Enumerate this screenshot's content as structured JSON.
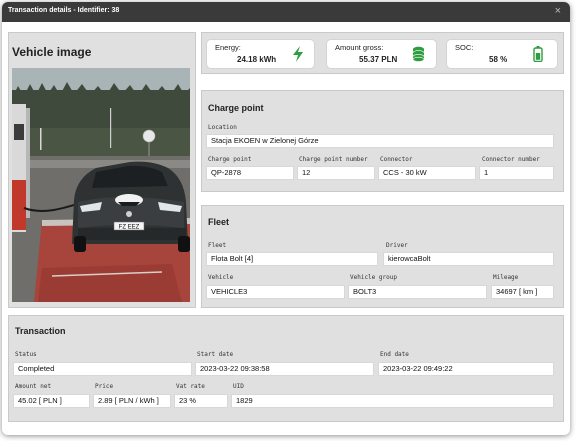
{
  "window": {
    "title": "Transaction details - Identifier: 38",
    "close_icon": "close-icon"
  },
  "vehicle_image": {
    "title": "Vehicle image",
    "plate_text": "FZ EEZ"
  },
  "stats": {
    "energy": {
      "label": "Energy:",
      "value": "24.18 kWh",
      "icon": "lightning-icon",
      "color": "#2e9d3f"
    },
    "amount_gross": {
      "label": "Amount gross:",
      "value": "55.37 PLN",
      "icon": "coins-icon",
      "color": "#2e9d3f"
    },
    "soc": {
      "label": "SOC:",
      "value": "58 %",
      "icon": "battery-icon",
      "color": "#2e9d3f"
    }
  },
  "charge_point": {
    "title": "Charge point",
    "location_label": "Location",
    "location_value": "Stacja EKOEN w Zielonej Górze",
    "cp_label": "Charge point",
    "cp_value": "QP-2878",
    "cp_number_label": "Charge point number",
    "cp_number_value": "12",
    "connector_label": "Connector",
    "connector_value": "CCS - 30 kW",
    "connector_number_label": "Connector number",
    "connector_number_value": "1"
  },
  "fleet": {
    "title": "Fleet",
    "fleet_label": "Fleet",
    "fleet_value": "Flota Bolt [4]",
    "driver_label": "Driver",
    "driver_value": "kierowcaBolt",
    "vehicle_label": "Vehicle",
    "vehicle_value": "VEHICLE3",
    "vehicle_group_label": "Vehicle group",
    "vehicle_group_value": "BOLT3",
    "mileage_label": "Mileage",
    "mileage_value": "34697 [ km ]"
  },
  "transaction": {
    "title": "Transaction",
    "status_label": "Status",
    "status_value": "Completed",
    "start_label": "Start date",
    "start_value": "2023-03-22 09:38:58",
    "end_label": "End date",
    "end_value": "2023-03-22 09:49:22",
    "amount_net_label": "Amount net",
    "amount_net_value": "45.02 [ PLN ]",
    "price_label": "Price",
    "price_value": "2.89 [ PLN / kWh ]",
    "vat_label": "Vat rate",
    "vat_value": "23 %",
    "uid_label": "UID",
    "uid_value": "1829"
  }
}
